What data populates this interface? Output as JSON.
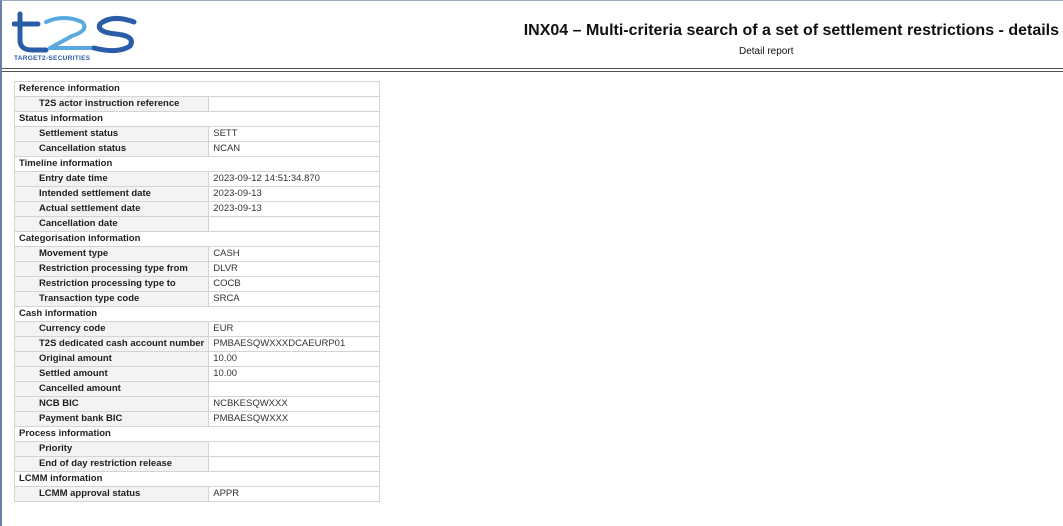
{
  "header": {
    "logo_text": "TARGET2-SECURITIES",
    "title": "INX04 – Multi-criteria search of a set of settlement restrictions - details",
    "subtitle": "Detail report",
    "brand_colors": {
      "primary": "#2a5ca8",
      "accent": "#5aa8e0"
    }
  },
  "report": {
    "sections": [
      {
        "title": "Reference information",
        "rows": [
          {
            "label": "T2S actor instruction reference",
            "value": ""
          }
        ]
      },
      {
        "title": "Status information",
        "rows": [
          {
            "label": "Settlement status",
            "value": "SETT"
          },
          {
            "label": "Cancellation status",
            "value": "NCAN"
          }
        ]
      },
      {
        "title": "Timeline information",
        "rows": [
          {
            "label": "Entry date time",
            "value": "2023-09-12 14:51:34.870"
          },
          {
            "label": "Intended settlement date",
            "value": "2023-09-13"
          },
          {
            "label": "Actual settlement date",
            "value": "2023-09-13"
          },
          {
            "label": "Cancellation date",
            "value": ""
          }
        ]
      },
      {
        "title": "Categorisation information",
        "rows": [
          {
            "label": "Movement type",
            "value": "CASH"
          },
          {
            "label": "Restriction processing type from",
            "value": "DLVR"
          },
          {
            "label": "Restriction processing type to",
            "value": "COCB"
          },
          {
            "label": "Transaction type code",
            "value": "SRCA"
          }
        ]
      },
      {
        "title": "Cash information",
        "rows": [
          {
            "label": "Currency code",
            "value": "EUR"
          },
          {
            "label": "T2S dedicated cash account number",
            "value": "PMBAESQWXXXDCAEURP01"
          },
          {
            "label": "Original amount",
            "value": "10.00"
          },
          {
            "label": "Settled amount",
            "value": "10.00"
          },
          {
            "label": "Cancelled amount",
            "value": ""
          },
          {
            "label": "NCB BIC",
            "value": "NCBKESQWXXX"
          },
          {
            "label": "Payment bank BIC",
            "value": "PMBAESQWXXX"
          }
        ]
      },
      {
        "title": "Process information",
        "rows": [
          {
            "label": "Priority",
            "value": ""
          },
          {
            "label": "End of day restriction release",
            "value": ""
          }
        ]
      },
      {
        "title": "LCMM information",
        "rows": [
          {
            "label": "LCMM approval status",
            "value": "APPR"
          }
        ]
      }
    ]
  }
}
